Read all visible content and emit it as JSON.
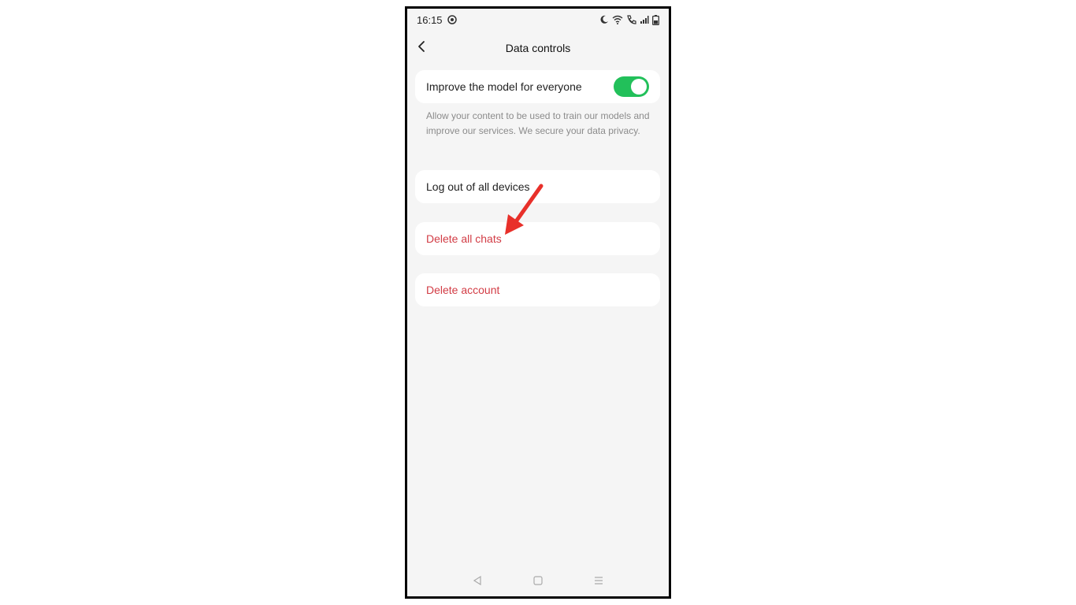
{
  "status_bar": {
    "time": "16:15",
    "icons": [
      "notification-icon",
      "moon-icon",
      "wifi-icon",
      "call-icon",
      "signal-icon",
      "battery-icon"
    ]
  },
  "header": {
    "title": "Data controls",
    "back_icon": "chevron-left-icon"
  },
  "settings": {
    "improve_model": {
      "label": "Improve the model for everyone",
      "enabled": true,
      "description": "Allow your content to be used to train our models and improve our services. We secure your data privacy."
    },
    "logout_all": {
      "label": "Log out of all devices"
    },
    "delete_chats": {
      "label": "Delete all chats"
    },
    "delete_account": {
      "label": "Delete account"
    }
  },
  "nav_bar": {
    "icons": [
      "back-triangle-icon",
      "home-square-icon",
      "menu-lines-icon"
    ]
  },
  "colors": {
    "toggle_on": "#22c05a",
    "danger": "#d23c45",
    "annotation_arrow": "#e8302a",
    "background": "#f5f5f5"
  }
}
